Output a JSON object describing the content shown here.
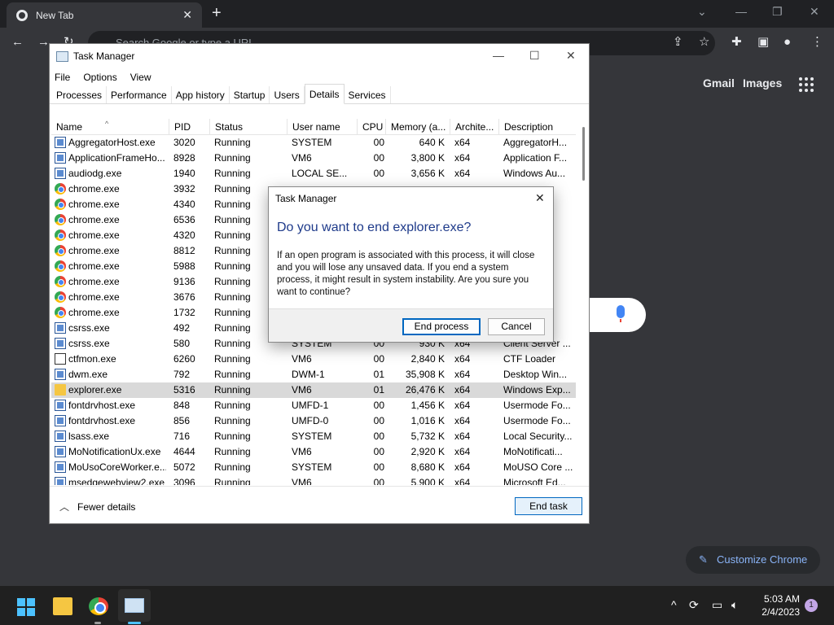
{
  "browser": {
    "tab_title": "New Tab",
    "omnibox_placeholder": "Search Google or type a URL",
    "links": {
      "gmail": "Gmail",
      "images": "Images"
    },
    "customize_label": "Customize Chrome"
  },
  "task_manager": {
    "title": "Task Manager",
    "menu": [
      "File",
      "Options",
      "View"
    ],
    "tabs": [
      "Processes",
      "Performance",
      "App history",
      "Startup",
      "Users",
      "Details",
      "Services"
    ],
    "active_tab": "Details",
    "columns": [
      "Name",
      "PID",
      "Status",
      "User name",
      "CPU",
      "Memory (a...",
      "Archite...",
      "Description"
    ],
    "rows": [
      {
        "icon": "win",
        "name": "AggregatorHost.exe",
        "pid": "3020",
        "status": "Running",
        "user": "SYSTEM",
        "cpu": "00",
        "mem": "640 K",
        "arch": "x64",
        "desc": "AggregatorH..."
      },
      {
        "icon": "win",
        "name": "ApplicationFrameHo...",
        "pid": "8928",
        "status": "Running",
        "user": "VM6",
        "cpu": "00",
        "mem": "3,800 K",
        "arch": "x64",
        "desc": "Application F..."
      },
      {
        "icon": "win",
        "name": "audiodg.exe",
        "pid": "1940",
        "status": "Running",
        "user": "LOCAL SE...",
        "cpu": "00",
        "mem": "3,656 K",
        "arch": "x64",
        "desc": "Windows Au..."
      },
      {
        "icon": "chrome",
        "name": "chrome.exe",
        "pid": "3932",
        "status": "Running",
        "user": "",
        "cpu": "",
        "mem": "",
        "arch": "",
        "desc": ""
      },
      {
        "icon": "chrome",
        "name": "chrome.exe",
        "pid": "4340",
        "status": "Running",
        "user": "",
        "cpu": "",
        "mem": "",
        "arch": "",
        "desc": ""
      },
      {
        "icon": "chrome",
        "name": "chrome.exe",
        "pid": "6536",
        "status": "Running",
        "user": "",
        "cpu": "",
        "mem": "",
        "arch": "",
        "desc": ""
      },
      {
        "icon": "chrome",
        "name": "chrome.exe",
        "pid": "4320",
        "status": "Running",
        "user": "",
        "cpu": "",
        "mem": "",
        "arch": "",
        "desc": ""
      },
      {
        "icon": "chrome",
        "name": "chrome.exe",
        "pid": "8812",
        "status": "Running",
        "user": "",
        "cpu": "",
        "mem": "",
        "arch": "",
        "desc": ""
      },
      {
        "icon": "chrome",
        "name": "chrome.exe",
        "pid": "5988",
        "status": "Running",
        "user": "",
        "cpu": "",
        "mem": "",
        "arch": "",
        "desc": ""
      },
      {
        "icon": "chrome",
        "name": "chrome.exe",
        "pid": "9136",
        "status": "Running",
        "user": "",
        "cpu": "",
        "mem": "",
        "arch": "",
        "desc": ""
      },
      {
        "icon": "chrome",
        "name": "chrome.exe",
        "pid": "3676",
        "status": "Running",
        "user": "",
        "cpu": "",
        "mem": "",
        "arch": "",
        "desc": ""
      },
      {
        "icon": "chrome",
        "name": "chrome.exe",
        "pid": "1732",
        "status": "Running",
        "user": "",
        "cpu": "",
        "mem": "",
        "arch": "",
        "desc": ""
      },
      {
        "icon": "win",
        "name": "csrss.exe",
        "pid": "492",
        "status": "Running",
        "user": "",
        "cpu": "",
        "mem": "",
        "arch": "",
        "desc": ""
      },
      {
        "icon": "win",
        "name": "csrss.exe",
        "pid": "580",
        "status": "Running",
        "user": "SYSTEM",
        "cpu": "00",
        "mem": "930 K",
        "arch": "x64",
        "desc": "Client Server ..."
      },
      {
        "icon": "pen",
        "name": "ctfmon.exe",
        "pid": "6260",
        "status": "Running",
        "user": "VM6",
        "cpu": "00",
        "mem": "2,840 K",
        "arch": "x64",
        "desc": "CTF Loader"
      },
      {
        "icon": "win",
        "name": "dwm.exe",
        "pid": "792",
        "status": "Running",
        "user": "DWM-1",
        "cpu": "01",
        "mem": "35,908 K",
        "arch": "x64",
        "desc": "Desktop Win..."
      },
      {
        "icon": "folder",
        "name": "explorer.exe",
        "pid": "5316",
        "status": "Running",
        "user": "VM6",
        "cpu": "01",
        "mem": "26,476 K",
        "arch": "x64",
        "desc": "Windows Exp..."
      },
      {
        "icon": "win",
        "name": "fontdrvhost.exe",
        "pid": "848",
        "status": "Running",
        "user": "UMFD-1",
        "cpu": "00",
        "mem": "1,456 K",
        "arch": "x64",
        "desc": "Usermode Fo..."
      },
      {
        "icon": "win",
        "name": "fontdrvhost.exe",
        "pid": "856",
        "status": "Running",
        "user": "UMFD-0",
        "cpu": "00",
        "mem": "1,016 K",
        "arch": "x64",
        "desc": "Usermode Fo..."
      },
      {
        "icon": "win",
        "name": "lsass.exe",
        "pid": "716",
        "status": "Running",
        "user": "SYSTEM",
        "cpu": "00",
        "mem": "5,732 K",
        "arch": "x64",
        "desc": "Local Security..."
      },
      {
        "icon": "win",
        "name": "MoNotificationUx.exe",
        "pid": "4644",
        "status": "Running",
        "user": "VM6",
        "cpu": "00",
        "mem": "2,920 K",
        "arch": "x64",
        "desc": "MoNotificati..."
      },
      {
        "icon": "win",
        "name": "MoUsoCoreWorker.e...",
        "pid": "5072",
        "status": "Running",
        "user": "SYSTEM",
        "cpu": "00",
        "mem": "8,680 K",
        "arch": "x64",
        "desc": "MoUSO Core ..."
      },
      {
        "icon": "win",
        "name": "msedgewebview2.exe",
        "pid": "3096",
        "status": "Running",
        "user": "VM6",
        "cpu": "00",
        "mem": "5,900 K",
        "arch": "x64",
        "desc": "Microsoft Ed..."
      }
    ],
    "selected_row": 16,
    "fewer_details": "Fewer details",
    "end_task": "End task"
  },
  "dialog": {
    "title": "Task Manager",
    "main_instruction": "Do you want to end explorer.exe?",
    "body": "If an open program is associated with this process, it will close and you will lose any unsaved data. If you end a system process, it might result in system instability. Are you sure you want to continue?",
    "primary_button": "End process",
    "secondary_button": "Cancel"
  },
  "taskbar": {
    "time": "5:03 AM",
    "date": "2/4/2023",
    "notification_count": "1"
  },
  "colors": {
    "selection": "#d9d9d9",
    "dialog_heading": "#1e3a8a",
    "accent": "#0067c0"
  }
}
